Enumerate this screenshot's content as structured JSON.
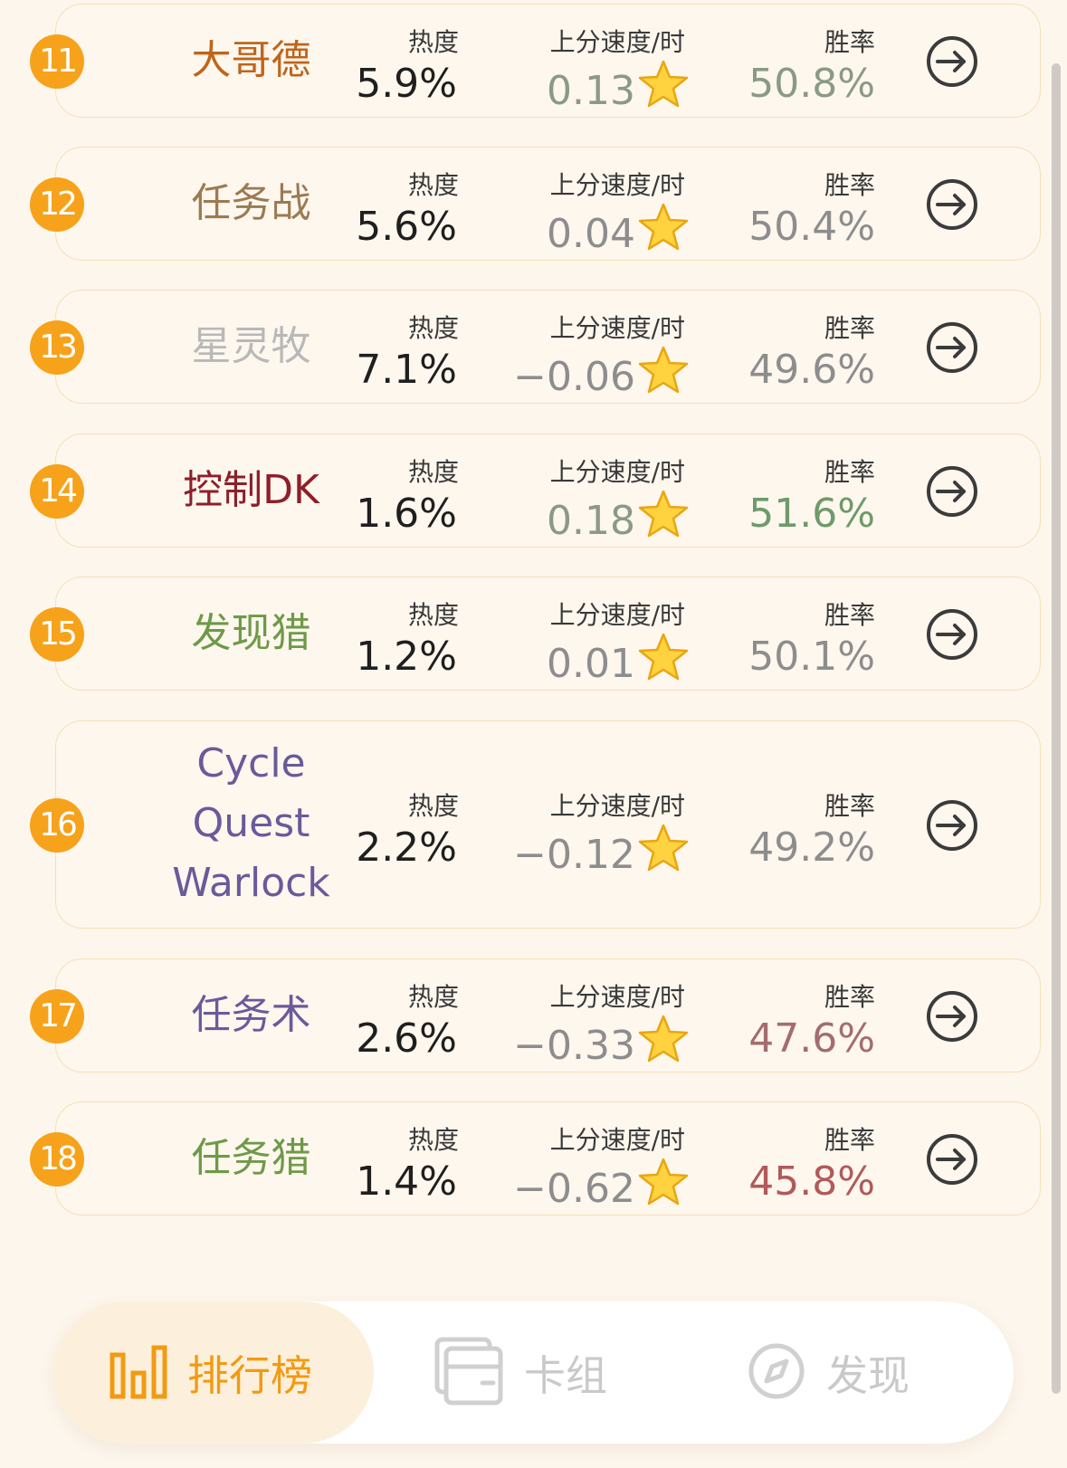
{
  "header_labels": {
    "heat": "热度",
    "speed": "上分速度/时",
    "winrate": "胜率"
  },
  "rows": [
    {
      "rank": "11",
      "name": "大哥德",
      "name_color": "#c0641a",
      "heat": "5.9%",
      "speed": "0.13",
      "winrate": "50.8%",
      "winrate_color": "#8a9a84",
      "speed_color": "#8a9a84"
    },
    {
      "rank": "12",
      "name": "任务战",
      "name_color": "#9c7a52",
      "heat": "5.6%",
      "speed": "0.04",
      "winrate": "50.4%",
      "winrate_color": "#8d8d8d",
      "speed_color": "#8d8d8d"
    },
    {
      "rank": "13",
      "name": "星灵牧",
      "name_color": "#b8b8b8",
      "heat": "7.1%",
      "speed": "−0.06",
      "winrate": "49.6%",
      "winrate_color": "#8d8d8d",
      "speed_color": "#8d8d8d"
    },
    {
      "rank": "14",
      "name": "控制DK",
      "name_color": "#8e1f2a",
      "heat": "1.6%",
      "speed": "0.18",
      "winrate": "51.6%",
      "winrate_color": "#6f9a69",
      "speed_color": "#8a9a84"
    },
    {
      "rank": "15",
      "name": "发现猎",
      "name_color": "#6e9a48",
      "heat": "1.2%",
      "speed": "0.01",
      "winrate": "50.1%",
      "winrate_color": "#8d8d8d",
      "speed_color": "#8d8d8d"
    },
    {
      "rank": "16",
      "name_lines": [
        "Cycle",
        "Quest",
        "Warlock"
      ],
      "name_color": "#6a5a9a",
      "heat": "2.2%",
      "speed": "−0.12",
      "winrate": "49.2%",
      "winrate_color": "#8d8d8d",
      "speed_color": "#8d8d8d"
    },
    {
      "rank": "17",
      "name": "任务术",
      "name_color": "#6a5a9a",
      "heat": "2.6%",
      "speed": "−0.33",
      "winrate": "47.6%",
      "winrate_color": "#a36d6d",
      "speed_color": "#8d8d8d"
    },
    {
      "rank": "18",
      "name": "任务猎",
      "name_color": "#6e9a48",
      "heat": "1.4%",
      "speed": "−0.62",
      "winrate": "45.8%",
      "winrate_color": "#b05a5a",
      "speed_color": "#8d8d8d"
    }
  ],
  "nav": {
    "items": [
      {
        "label": "排行榜",
        "icon": "bar-chart-icon",
        "active": true
      },
      {
        "label": "卡组",
        "icon": "deck-cards-icon",
        "active": false
      },
      {
        "label": "发现",
        "icon": "compass-icon",
        "active": false
      }
    ],
    "active_color": "#f29a12",
    "inactive_color": "#c9c9c9"
  }
}
